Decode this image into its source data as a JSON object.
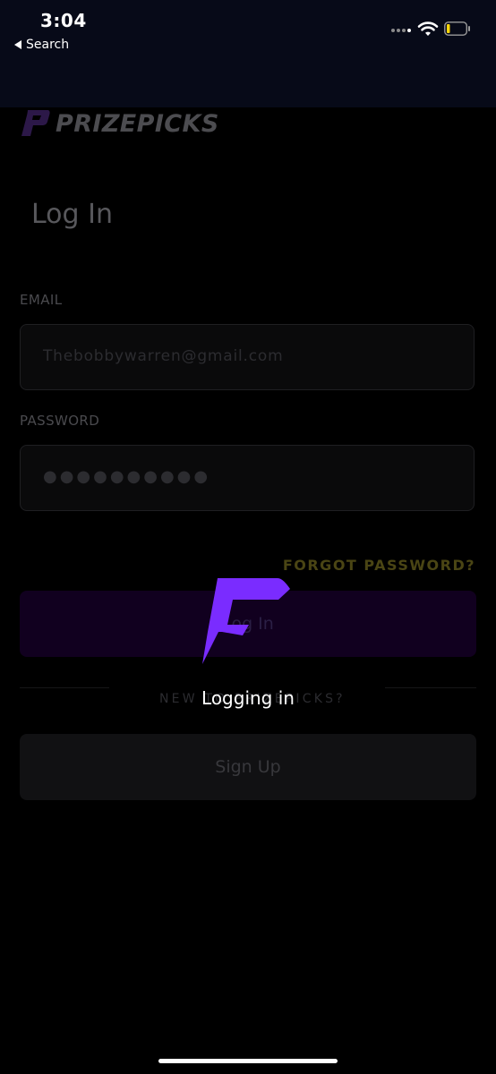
{
  "status_bar": {
    "time": "3:04",
    "back_app": "Search",
    "icons": [
      "signal-icon",
      "wifi-icon",
      "battery-icon"
    ]
  },
  "logo": {
    "text": "PRIZEPICKS"
  },
  "login": {
    "title": "Log In",
    "email_label": "EMAIL",
    "email_value": "Thebobbywarren@gmail.com",
    "password_label": "PASSWORD",
    "password_value": "●●●●●●●●●●",
    "forgot_label": "FORGOT PASSWORD?",
    "login_button": "Log In",
    "new_to_text": "NEW TO PRIZEPICKS?",
    "signup_button": "Sign Up"
  },
  "overlay": {
    "loading_text": "Logging in"
  },
  "colors": {
    "accent": "#7a2cff",
    "status_bar_bg": "#070a18",
    "background": "#000000"
  }
}
